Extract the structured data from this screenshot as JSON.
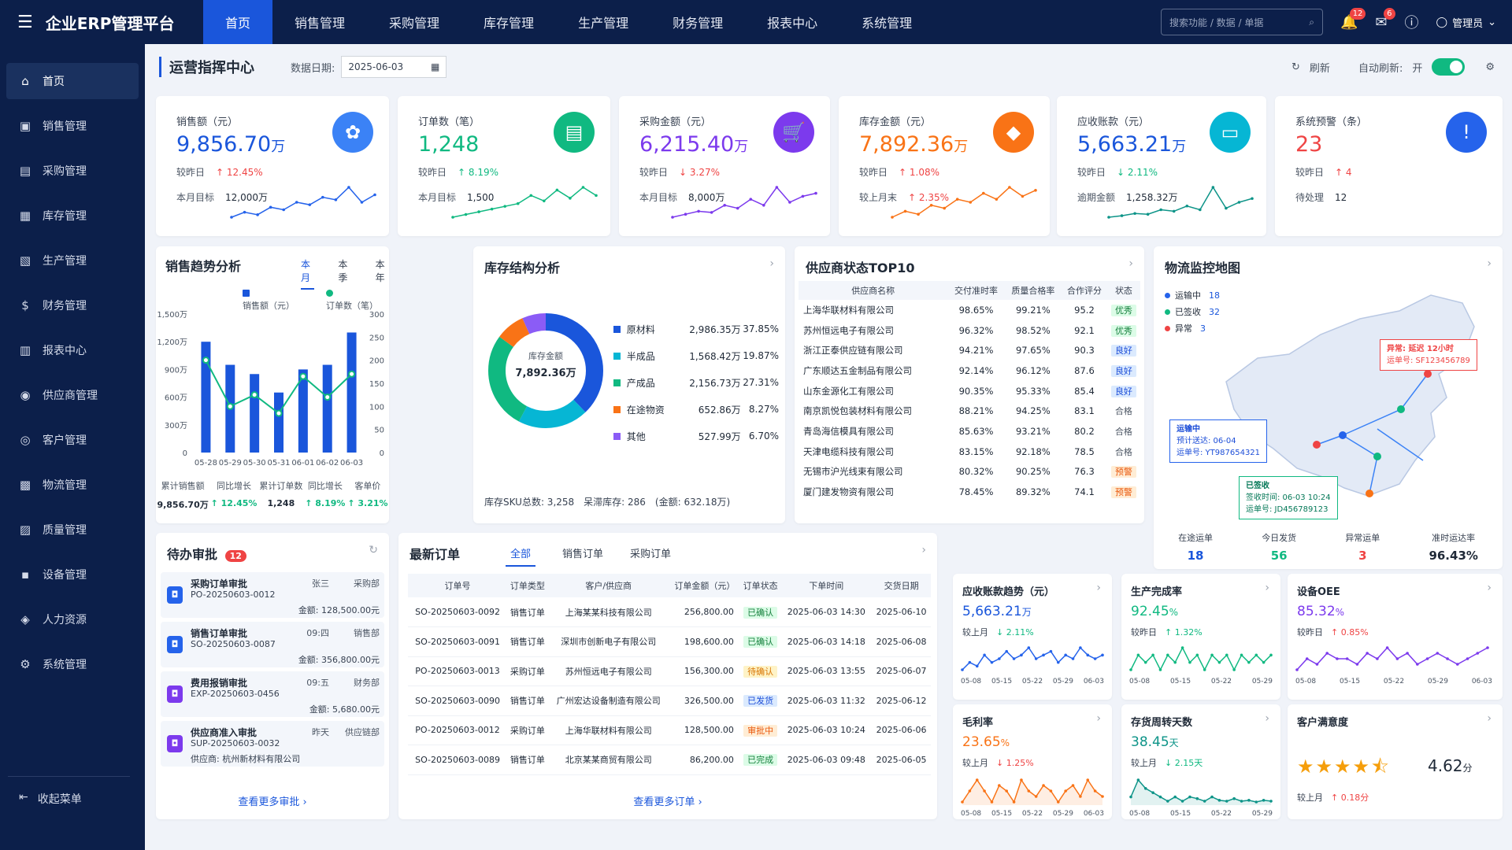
{
  "brand": {
    "title": "企业ERP管理平台",
    "menu_icon": "hamburger-icon"
  },
  "topnav": [
    "首页",
    "销售管理",
    "采购管理",
    "库存管理",
    "生产管理",
    "财务管理",
    "报表中心",
    "系统管理"
  ],
  "topbar": {
    "search_placeholder": "搜索功能 / 数据 / 单据",
    "notify_count": "12",
    "mail_count": "6",
    "user": "管理员"
  },
  "sidebar": [
    {
      "label": "首页",
      "icon": "⌂"
    },
    {
      "label": "销售管理",
      "icon": "▣"
    },
    {
      "label": "采购管理",
      "icon": "▤"
    },
    {
      "label": "库存管理",
      "icon": "▦"
    },
    {
      "label": "生产管理",
      "icon": "▧"
    },
    {
      "label": "财务管理",
      "icon": "$"
    },
    {
      "label": "报表中心",
      "icon": "▥"
    },
    {
      "label": "供应商管理",
      "icon": "◉"
    },
    {
      "label": "客户管理",
      "icon": "◎"
    },
    {
      "label": "物流管理",
      "icon": "▩"
    },
    {
      "label": "质量管理",
      "icon": "▨"
    },
    {
      "label": "设备管理",
      "icon": "▪"
    },
    {
      "label": "人力资源",
      "icon": "◈"
    },
    {
      "label": "系统管理",
      "icon": "⚙"
    }
  ],
  "sidebar_collapse": "收起菜单",
  "header": {
    "title": "运营指挥中心",
    "date_label": "数据日期:",
    "date_value": "2025-06-03",
    "refresh": "刷新",
    "auto_refresh": "自动刷新:",
    "auto_on": "开"
  },
  "kpis": [
    {
      "title": "销售额（元）",
      "value": "9,856.70",
      "unit": "万",
      "color": "#1a56db",
      "icon_bg": "#3b82f6",
      "icon": "✿",
      "cmp_label": "较昨日",
      "cmp": "↑ 12.45%",
      "cmp_dir": "up",
      "t_label": "本月目标",
      "t_value": "12,000万",
      "spark": [
        3,
        4,
        3.5,
        5,
        4.5,
        6,
        5.5,
        7,
        6.5,
        9,
        6,
        7.5
      ],
      "spark_color": "#2563eb"
    },
    {
      "title": "订单数（笔）",
      "value": "1,248",
      "unit": "",
      "color": "#10b981",
      "icon_bg": "#10b981",
      "icon": "▤",
      "cmp_label": "较昨日",
      "cmp": "↑ 8.19%",
      "cmp_dir": "down",
      "t_label": "本月目标",
      "t_value": "1,500",
      "spark": [
        3,
        3.5,
        4,
        4.5,
        5,
        5.5,
        7,
        6,
        8,
        6.5,
        8.5,
        7
      ],
      "spark_color": "#10b981"
    },
    {
      "title": "采购金额（元）",
      "value": "6,215.40",
      "unit": "万",
      "color": "#7c3aed",
      "icon_bg": "#7c3aed",
      "icon": "🛒",
      "cmp_label": "较昨日",
      "cmp": "↓ 3.27%",
      "cmp_dir": "up",
      "t_label": "本月目标",
      "t_value": "8,000万",
      "spark": [
        3,
        3.5,
        4,
        3.8,
        5,
        4.5,
        6,
        5,
        8,
        5.5,
        6.5,
        7
      ],
      "spark_color": "#7c3aed"
    },
    {
      "title": "库存金额（元）",
      "value": "7,892.36",
      "unit": "万",
      "color": "#f97316",
      "icon_bg": "#f97316",
      "icon": "◆",
      "cmp_label": "较昨日",
      "cmp": "↑ 1.08%",
      "cmp_dir": "up",
      "t_label": "较上月末",
      "t_value": "↑ 2.35%",
      "spark": [
        3,
        4,
        3.5,
        5,
        4.5,
        6,
        5.5,
        7,
        6,
        8,
        6.5,
        7.5
      ],
      "spark_color": "#f97316"
    },
    {
      "title": "应收账款（元）",
      "value": "5,663.21",
      "unit": "万",
      "color": "#1a56db",
      "icon_bg": "#06b6d4",
      "icon": "▭",
      "cmp_label": "较昨日",
      "cmp": "↓ 2.11%",
      "cmp_dir": "down",
      "t_label": "逾期金额",
      "t_value": "1,258.32万",
      "spark": [
        3,
        3.2,
        3.5,
        3.4,
        4,
        3.8,
        4.5,
        4,
        7,
        4.2,
        5,
        5.5
      ],
      "spark_color": "#0d9488"
    },
    {
      "title": "系统预警（条）",
      "value": "23",
      "unit": "",
      "color": "#ef4444",
      "icon_bg": "#2563eb",
      "icon": "!",
      "cmp_label": "较昨日",
      "cmp": "↑ 4",
      "cmp_dir": "up",
      "t_label": "待处理",
      "t_value": "12",
      "spark": [],
      "spark_color": "#2563eb"
    }
  ],
  "sales_trend": {
    "title": "销售趋势分析",
    "tabs": [
      "本月",
      "本季",
      "本年"
    ],
    "legend": [
      "销售额（元）",
      "订单数（笔）"
    ],
    "stats": [
      {
        "label": "累计销售额",
        "value": "9,856.70万"
      },
      {
        "label": "同比增长",
        "value": "↑ 12.45%"
      },
      {
        "label": "累计订单数",
        "value": "1,248"
      },
      {
        "label": "同比增长",
        "value": "↑ 8.19%"
      },
      {
        "label": "客单价",
        "value": "↑ 3.21%"
      }
    ]
  },
  "chart_data": [
    {
      "type": "bar",
      "title": "销售趋势分析",
      "categories": [
        "05-28",
        "05-29",
        "05-30",
        "05-31",
        "06-01",
        "06-02",
        "06-03"
      ],
      "series": [
        {
          "name": "销售额（元）",
          "values": [
            1200,
            950,
            850,
            650,
            900,
            950,
            1300
          ]
        },
        {
          "name": "订单数（笔）",
          "values": [
            200,
            100,
            125,
            85,
            165,
            120,
            170
          ]
        }
      ],
      "y_ticks_left": [
        "1,500万",
        "1,200万",
        "900万",
        "600万",
        "300万",
        "0"
      ],
      "y_ticks_right": [
        "300",
        "250",
        "200",
        "150",
        "100",
        "50",
        "0"
      ],
      "ylim": [
        0,
        1500
      ],
      "ylim_right": [
        0,
        300
      ]
    },
    {
      "type": "pie",
      "title": "库存结构分析",
      "center_label": "库存金额",
      "center_value": "7,892.36万",
      "series": [
        {
          "name": "原材料",
          "value": "2,986.35万",
          "pct": "37.85%",
          "frac": 0.3785,
          "color": "#1a56db"
        },
        {
          "name": "半成品",
          "value": "1,568.42万",
          "pct": "19.87%",
          "frac": 0.1987,
          "color": "#06b6d4"
        },
        {
          "name": "产成品",
          "value": "2,156.73万",
          "pct": "27.31%",
          "frac": 0.2731,
          "color": "#10b981"
        },
        {
          "name": "在途物资",
          "value": "652.86万",
          "pct": "8.27%",
          "frac": 0.0827,
          "color": "#f97316"
        },
        {
          "name": "其他",
          "value": "527.99万",
          "pct": "6.70%",
          "frac": 0.067,
          "color": "#8b5cf6"
        }
      ]
    }
  ],
  "inventory": {
    "title": "库存结构分析",
    "footer": "库存SKU总数: 3,258　呆滞库存: 286　(金额: 632.18万)"
  },
  "suppliers": {
    "title": "供应商状态TOP10",
    "headers": [
      "供应商名称",
      "交付准时率",
      "质量合格率",
      "合作评分",
      "状态"
    ],
    "rows": [
      [
        "上海华联材料有限公司",
        "98.65%",
        "99.21%",
        "95.2",
        "优秀",
        "s-ok"
      ],
      [
        "苏州恒远电子有限公司",
        "96.32%",
        "98.52%",
        "92.1",
        "优秀",
        "s-ok"
      ],
      [
        "浙江正泰供应链有限公司",
        "94.21%",
        "97.65%",
        "90.3",
        "良好",
        "s-good"
      ],
      [
        "广东顺达五金制品有限公司",
        "92.14%",
        "96.12%",
        "87.6",
        "良好",
        "s-good"
      ],
      [
        "山东金源化工有限公司",
        "90.35%",
        "95.33%",
        "85.4",
        "良好",
        "s-good"
      ],
      [
        "南京凯悦包装材料有限公司",
        "88.21%",
        "94.25%",
        "83.1",
        "合格",
        "s-norm"
      ],
      [
        "青岛海信模具有限公司",
        "85.63%",
        "93.21%",
        "80.2",
        "合格",
        "s-norm"
      ],
      [
        "天津电缆科技有限公司",
        "83.15%",
        "92.18%",
        "78.5",
        "合格",
        "s-norm"
      ],
      [
        "无锡市沪光线束有限公司",
        "80.32%",
        "90.25%",
        "76.3",
        "预警",
        "s-warn"
      ],
      [
        "厦门建发物资有限公司",
        "78.45%",
        "89.32%",
        "74.1",
        "预警",
        "s-warn"
      ]
    ]
  },
  "logistics": {
    "title": "物流监控地图",
    "legend": [
      {
        "label": "运输中",
        "value": "18",
        "color": "#2563eb"
      },
      {
        "label": "已签收",
        "value": "32",
        "color": "#10b981"
      },
      {
        "label": "异常",
        "value": "3",
        "color": "#ef4444"
      }
    ],
    "popup_err": {
      "t": "异常: 延迟 12小时",
      "s": "运单号: SF123456789"
    },
    "popup_transit": {
      "t": "运输中",
      "s1": "预计送达: 06-04",
      "s2": "运单号: YT987654321"
    },
    "popup_signed": {
      "t": "已签收",
      "s1": "签收时间: 06-03 10:24",
      "s2": "运单号: JD456789123"
    },
    "stats": [
      {
        "label": "在途运单",
        "value": "18",
        "color": "#1a56db"
      },
      {
        "label": "今日发货",
        "value": "56",
        "color": "#10b981"
      },
      {
        "label": "异常运单",
        "value": "3",
        "color": "#ef4444"
      },
      {
        "label": "准时运达率",
        "value": "96.43%",
        "color": "#1f2937"
      }
    ]
  },
  "approvals": {
    "title": "待办审批",
    "count": "12",
    "more": "查看更多审批 ›",
    "items": [
      {
        "title": "采购订单审批",
        "code": "PO-20250603-0012",
        "who": "张三",
        "dept": "采购部",
        "detail": "金额: 128,500.00元",
        "color": "#2563eb"
      },
      {
        "title": "销售订单审批",
        "code": "SO-20250603-0087",
        "who": "09:四",
        "dept": "销售部",
        "detail": "金额: 356,800.00元",
        "color": "#2563eb"
      },
      {
        "title": "费用报销审批",
        "code": "EXP-20250603-0456",
        "who": "09:五",
        "dept": "财务部",
        "detail": "金额: 5,680.00元",
        "color": "#7c3aed"
      },
      {
        "title": "供应商准入审批",
        "code": "SUP-20250603-0032",
        "who": "昨天",
        "dept": "供应链部",
        "detail": "供应商: 杭州新材料有限公司",
        "color": "#7c3aed"
      }
    ]
  },
  "orders": {
    "title": "最新订单",
    "tabs": [
      "全部",
      "销售订单",
      "采购订单"
    ],
    "more": "查看更多订单 ›",
    "headers": [
      "订单号",
      "订单类型",
      "客户/供应商",
      "订单金额（元）",
      "订单状态",
      "下单时间",
      "交货日期"
    ],
    "rows": [
      [
        "SO-20250603-0092",
        "销售订单",
        "上海某某科技有限公司",
        "256,800.00",
        "已确认",
        "o-confirm",
        "2025-06-03 14:30",
        "2025-06-10"
      ],
      [
        "SO-20250603-0091",
        "销售订单",
        "深圳市创新电子有限公司",
        "198,600.00",
        "已确认",
        "o-confirm",
        "2025-06-03 14:18",
        "2025-06-08"
      ],
      [
        "PO-20250603-0013",
        "采购订单",
        "苏州恒远电子有限公司",
        "156,300.00",
        "待确认",
        "o-pend",
        "2025-06-03 13:55",
        "2025-06-07"
      ],
      [
        "SO-20250603-0090",
        "销售订单",
        "广州宏达设备制造有限公司",
        "326,500.00",
        "已发货",
        "o-ship",
        "2025-06-03 11:32",
        "2025-06-12"
      ],
      [
        "PO-20250603-0012",
        "采购订单",
        "上海华联材料有限公司",
        "128,500.00",
        "审批中",
        "o-audit",
        "2025-06-03 10:24",
        "2025-06-06"
      ],
      [
        "SO-20250603-0089",
        "销售订单",
        "北京某某商贸有限公司",
        "86,200.00",
        "已完成",
        "o-done",
        "2025-06-03 09:48",
        "2025-06-05"
      ]
    ]
  },
  "minis": [
    {
      "title": "应收账款趋势（元）",
      "value": "5,663.21",
      "unit": "万",
      "vcolor": "#1a56db",
      "cmp_label": "较上月",
      "cmp": "↓ 2.11%",
      "cdir": "down",
      "color": "#2563eb",
      "x": [
        "05-08",
        "05-15",
        "05-22",
        "05-29",
        "06-03"
      ],
      "spark": [
        3,
        4,
        3.5,
        5,
        4,
        4.5,
        5.5,
        4.5,
        5,
        6,
        4.5,
        5,
        5.5,
        4,
        5,
        4.5,
        6,
        5,
        4.5,
        5
      ]
    },
    {
      "title": "生产完成率",
      "value": "92.45",
      "unit": "%",
      "vcolor": "#10b981",
      "cmp_label": "较昨日",
      "cmp": "↑ 1.32%",
      "cdir": "down",
      "color": "#10b981",
      "x": [
        "05-08",
        "05-15",
        "05-22",
        "05-29"
      ],
      "spark": [
        4,
        5,
        4.5,
        5,
        4,
        5,
        4.5,
        5.5,
        4.5,
        5,
        4,
        5,
        4.5,
        5,
        4,
        5,
        4.5,
        5,
        4.5,
        5
      ]
    },
    {
      "title": "设备OEE",
      "value": "85.32",
      "unit": "%",
      "vcolor": "#7c3aed",
      "cmp_label": "较昨日",
      "cmp": "↑ 0.85%",
      "cdir": "up",
      "color": "#7c3aed",
      "x": [
        "05-08",
        "05-15",
        "05-22",
        "05-29",
        "06-03"
      ],
      "spark": [
        4,
        5,
        4.5,
        5.5,
        5,
        5,
        4.5,
        5.5,
        5,
        6,
        5,
        5.5,
        4.5,
        5,
        5.5,
        5,
        4.5,
        5,
        5.5,
        6
      ]
    },
    {
      "title": "毛利率",
      "value": "23.65",
      "unit": "%",
      "vcolor": "#f97316",
      "cmp_label": "较上月",
      "cmp": "↓ 1.25%",
      "cdir": "up",
      "color": "#f97316",
      "x": [
        "05-08",
        "05-15",
        "05-22",
        "05-29",
        "06-03"
      ],
      "spark": [
        4,
        5,
        6,
        5,
        4,
        5.5,
        5,
        4,
        6,
        5,
        4.5,
        5.5,
        5,
        4,
        5,
        5.5,
        4.5,
        6,
        5,
        4.5
      ]
    },
    {
      "title": "存货周转天数",
      "value": "38.45",
      "unit": "天",
      "vcolor": "#0d9488",
      "cmp_label": "较上月",
      "cmp": "↓ 2.15天",
      "cdir": "down",
      "color": "#0d9488",
      "x": [
        "05-08",
        "05-15",
        "05-22",
        "05-29"
      ],
      "spark": [
        4,
        6,
        5,
        4.5,
        4,
        3.5,
        4,
        3.5,
        4,
        3.8,
        3.5,
        4,
        3.6,
        3.5,
        3.8,
        3.5,
        3.6,
        3.4,
        3.6,
        3.5
      ]
    },
    {
      "title": "客户满意度",
      "value": "4.62",
      "unit": "分",
      "vcolor": "#1f2937",
      "cmp_label": "较上月",
      "cmp": "↑ 0.18分",
      "cdir": "up",
      "color": "#f59e0b",
      "rating": 4.62,
      "x": [],
      "spark": []
    }
  ]
}
